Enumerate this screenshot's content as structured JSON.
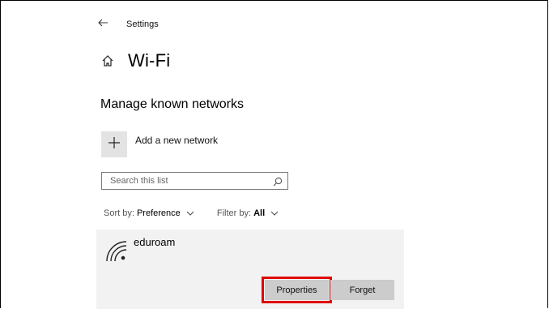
{
  "header": {
    "app_title": "Settings",
    "page_title": "Wi-Fi"
  },
  "main": {
    "section_title": "Manage known networks",
    "add_network_label": "Add a new network",
    "search": {
      "placeholder": "Search this list"
    },
    "sort": {
      "label": "Sort by:",
      "value": "Preference"
    },
    "filter": {
      "label": "Filter by:",
      "value": "All"
    },
    "networks": [
      {
        "name": "eduroam",
        "properties_label": "Properties",
        "forget_label": "Forget"
      }
    ]
  },
  "icons": {
    "back": "back-arrow-icon",
    "home": "home-icon",
    "add": "plus-icon",
    "search": "search-icon",
    "wifi": "wifi-icon",
    "caret": "chevron-down-icon"
  },
  "colors": {
    "highlight": "#e00000",
    "card_bg": "#f2f2f2",
    "button_bg": "#cccccc"
  }
}
